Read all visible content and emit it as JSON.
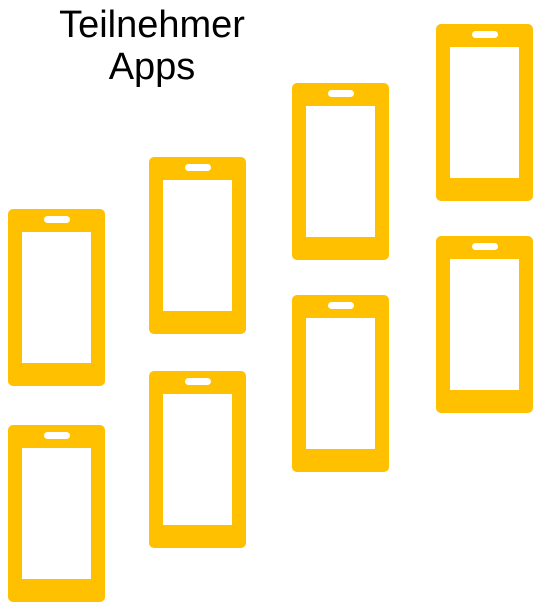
{
  "title": {
    "line1": "Teilnehmer",
    "line2": "Apps"
  },
  "colors": {
    "phone": "#FFC000",
    "screen": "#FFFFFF",
    "text": "#000000"
  },
  "phones": [
    {
      "icon": "smartphone-icon"
    },
    {
      "icon": "smartphone-icon"
    },
    {
      "icon": "smartphone-icon"
    },
    {
      "icon": "smartphone-icon"
    },
    {
      "icon": "smartphone-icon"
    },
    {
      "icon": "smartphone-icon"
    },
    {
      "icon": "smartphone-icon"
    },
    {
      "icon": "smartphone-icon"
    },
    {
      "icon": "smartphone-icon"
    }
  ]
}
